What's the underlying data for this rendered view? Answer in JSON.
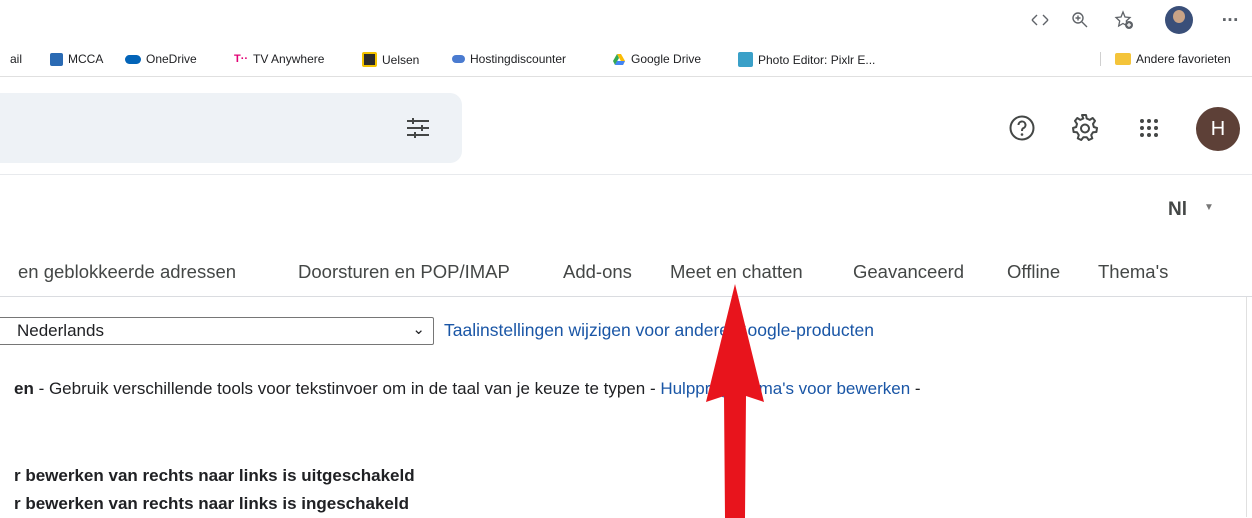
{
  "browser": {
    "bookmarks": [
      {
        "label": "ail",
        "icon": "gmail-icon"
      },
      {
        "label": "MCCA",
        "icon": "mcca-icon"
      },
      {
        "label": "OneDrive",
        "icon": "onedrive-icon"
      },
      {
        "label": "TV Anywhere",
        "icon": "telekom-icon"
      },
      {
        "label": "Uelsen",
        "icon": "uelsen-icon"
      },
      {
        "label": "Hostingdiscounter",
        "icon": "hostingdiscounter-icon"
      },
      {
        "label": "Google Drive",
        "icon": "google-drive-icon"
      },
      {
        "label": "Photo Editor: Pixlr E...",
        "icon": "pixlr-icon"
      }
    ],
    "other_favorites": "Andere favorieten",
    "more_menu": "···"
  },
  "header": {
    "account_initial": "H",
    "language_short": "Nl"
  },
  "tabs": [
    "en geblokkeerde adressen",
    "Doorsturen en POP/IMAP",
    "Add-ons",
    "Meet en chatten",
    "Geavanceerd",
    "Offline",
    "Thema's"
  ],
  "language": {
    "selected": "Nederlands",
    "change_link": "Taalinstellingen wijzigen voor andere Google-producten"
  },
  "input_tools": {
    "title": "en",
    "sep1": " - ",
    "description": "Gebruik verschillende tools voor tekstinvoer om in de taal van je keuze te typen",
    "sep2": " - ",
    "edit_link": "Hulpprogramma's voor bewerken",
    "sep3": " -"
  },
  "rtl": {
    "option_off": "r bewerken van rechts naar links is uitgeschakeld",
    "option_on": "r bewerken van rechts naar links is ingeschakeld"
  },
  "colors": {
    "annotation_arrow": "#e8141c",
    "link": "#1a56a6",
    "avatar": "#5d4037"
  }
}
